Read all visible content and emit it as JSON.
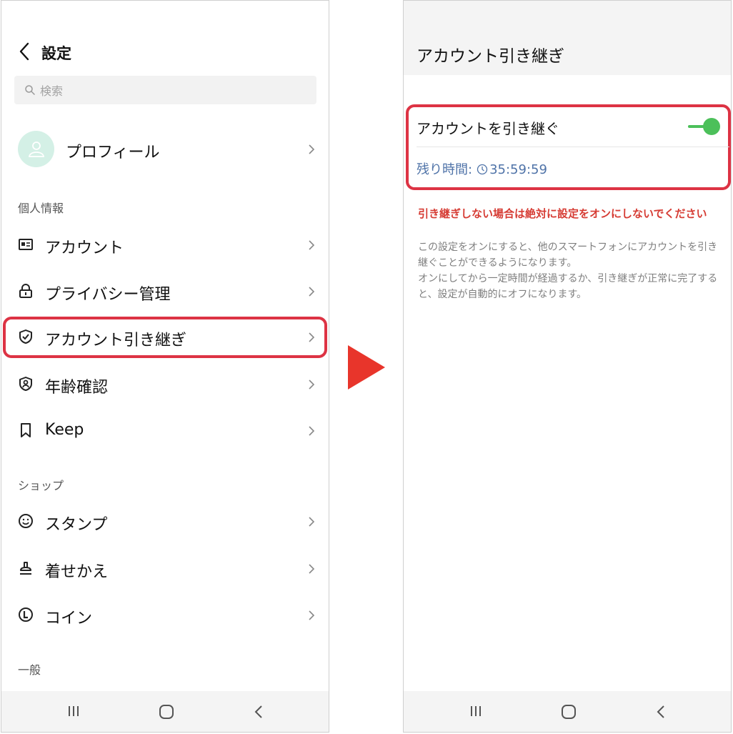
{
  "left_screen": {
    "header": {
      "title": "設定"
    },
    "search": {
      "placeholder": "検索"
    },
    "profile": {
      "label": "プロフィール"
    },
    "sections": [
      {
        "title": "個人情報"
      },
      {
        "title": "ショップ"
      },
      {
        "title": "一般"
      }
    ],
    "items": [
      {
        "label": "アカウント",
        "icon": "id-card-icon"
      },
      {
        "label": "プライバシー管理",
        "icon": "lock-icon"
      },
      {
        "label": "アカウント引き継ぎ",
        "icon": "shield-check-icon",
        "highlighted": true
      },
      {
        "label": "年齢確認",
        "icon": "person-badge-icon"
      },
      {
        "label": "Keep",
        "icon": "bookmark-icon"
      },
      {
        "label": "スタンプ",
        "icon": "smile-icon"
      },
      {
        "label": "着せかえ",
        "icon": "stamp-icon"
      },
      {
        "label": "コイン",
        "icon": "coin-icon"
      }
    ]
  },
  "right_screen": {
    "header": {
      "title": "アカウント引き継ぎ"
    },
    "toggle": {
      "label": "アカウントを引き継ぐ",
      "state": "on",
      "color": "#4cc05a"
    },
    "timer": {
      "label": "残り時間:",
      "value": "35:59:59"
    },
    "warning": "引き継ぎしない場合は絶対に設定をオンにしないでください",
    "description": [
      "この設定をオンにすると、他のスマートフォンにアカウントを引き継ぐことができるようになります。",
      "オンにしてから一定時間が経過するか、引き継ぎが正常に完了すると、設定が自動的にオフになります。"
    ]
  },
  "colors": {
    "highlight": "#dd3344",
    "arrow": "#e8352b",
    "timer_text": "#4f73a8",
    "warning_text": "#d63c34"
  }
}
